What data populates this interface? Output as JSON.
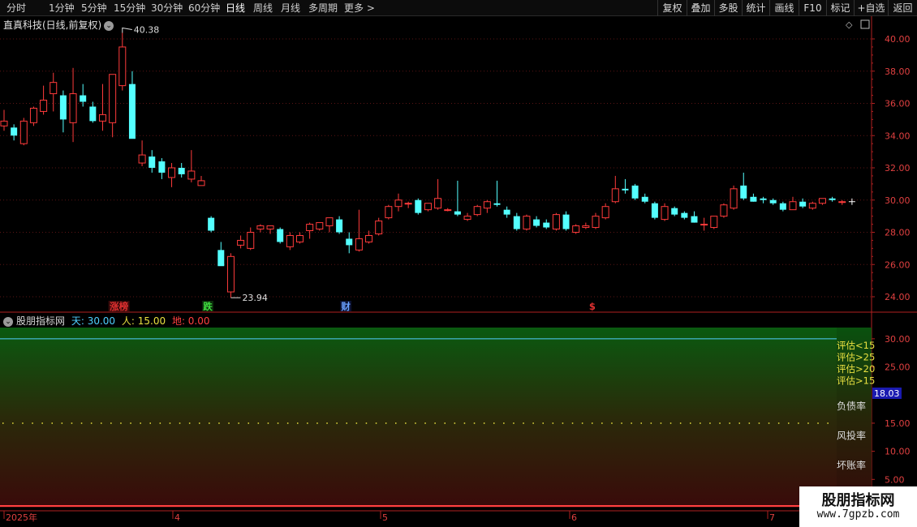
{
  "toolbar": {
    "periods": [
      "分时",
      "1分钟",
      "5分钟",
      "15分钟",
      "30分钟",
      "60分钟",
      "日线",
      "周线",
      "月线",
      "多周期",
      "更多 >"
    ],
    "active_period": "日线",
    "right_buttons": [
      "复权",
      "叠加",
      "多股",
      "统计",
      "画线",
      "F10",
      "标记",
      "+自选",
      "返回"
    ]
  },
  "main_chart": {
    "title": "直真科技(日线,前复权)",
    "high_label": "40.38",
    "low_label": "23.94",
    "y_ticks": [
      "40.00",
      "38.00",
      "36.00",
      "34.00",
      "32.00",
      "30.00",
      "28.00",
      "26.00",
      "24.00"
    ],
    "markers": [
      {
        "text": "涨榜",
        "color": "#e03030",
        "bg": "#3a0a0a"
      },
      {
        "text": "跌",
        "color": "#40e040",
        "bg": "#0a2a0a"
      },
      {
        "text": "财",
        "color": "#6aa0ff",
        "bg": "#0a1030"
      },
      {
        "text": "$",
        "color": "#e03030",
        "bg": "#000000"
      }
    ]
  },
  "indicator": {
    "name": "股朋指标网",
    "tian_label": "天: 30.00",
    "ren_label": "人: 15.00",
    "di_label": "地: 0.00",
    "y_ticks": [
      "30.00",
      "25.00",
      "15.00",
      "10.00",
      "5.00"
    ],
    "current_value": "18.03",
    "eval_labels": [
      "评估<15",
      "评估>25",
      "评估>20",
      "评估>15"
    ],
    "rate_labels": [
      "负债率",
      "风投率",
      "坏账率"
    ]
  },
  "x_axis": {
    "labels": [
      "2025年",
      "4",
      "5",
      "6",
      "7"
    ]
  },
  "watermark": {
    "line1": "股朋指标网",
    "line2": "www.7gpzb.com"
  },
  "colors": {
    "up": "#ff3b3b",
    "down": "#54ffff",
    "axis": "#b02020",
    "tian": "#4fd0ff",
    "ren": "#e8e040",
    "di": "#ff4040"
  },
  "chart_data": {
    "type": "candlestick",
    "title": "直真科技(日线,前复权)",
    "ylim": [
      23,
      41.5
    ],
    "candles": [
      {
        "o": 34.6,
        "h": 35.6,
        "l": 34.3,
        "c": 34.9
      },
      {
        "o": 34.5,
        "h": 34.7,
        "l": 33.7,
        "c": 34.0
      },
      {
        "o": 33.5,
        "h": 35.1,
        "l": 33.4,
        "c": 34.9
      },
      {
        "o": 34.8,
        "h": 35.8,
        "l": 34.6,
        "c": 35.7
      },
      {
        "o": 35.5,
        "h": 37.1,
        "l": 35.3,
        "c": 36.2
      },
      {
        "o": 36.6,
        "h": 37.9,
        "l": 35.5,
        "c": 37.3
      },
      {
        "o": 36.5,
        "h": 36.8,
        "l": 34.2,
        "c": 35.0
      },
      {
        "o": 34.8,
        "h": 38.2,
        "l": 33.6,
        "c": 36.6
      },
      {
        "o": 36.5,
        "h": 37.2,
        "l": 35.8,
        "c": 36.1
      },
      {
        "o": 35.8,
        "h": 36.1,
        "l": 34.8,
        "c": 34.9
      },
      {
        "o": 34.9,
        "h": 37.2,
        "l": 34.3,
        "c": 35.3
      },
      {
        "o": 34.8,
        "h": 37.5,
        "l": 33.9,
        "c": 37.8
      },
      {
        "o": 37.1,
        "h": 40.38,
        "l": 36.8,
        "c": 39.5
      },
      {
        "o": 37.2,
        "h": 38.0,
        "l": 34.0,
        "c": 33.8
      },
      {
        "o": 32.3,
        "h": 33.7,
        "l": 32.1,
        "c": 32.8
      },
      {
        "o": 32.7,
        "h": 33.1,
        "l": 31.7,
        "c": 32.0
      },
      {
        "o": 32.4,
        "h": 32.6,
        "l": 31.3,
        "c": 31.7
      },
      {
        "o": 31.4,
        "h": 32.3,
        "l": 30.8,
        "c": 32.0
      },
      {
        "o": 32.0,
        "h": 32.3,
        "l": 31.4,
        "c": 31.6
      },
      {
        "o": 31.3,
        "h": 33.1,
        "l": 31.1,
        "c": 31.8
      },
      {
        "o": 30.9,
        "h": 31.5,
        "l": 30.9,
        "c": 31.2
      },
      {
        "o": 28.9,
        "h": 29.0,
        "l": 28.0,
        "c": 28.1
      },
      {
        "o": 26.9,
        "h": 27.4,
        "l": 26.0,
        "c": 25.9
      },
      {
        "o": 24.3,
        "h": 26.7,
        "l": 23.94,
        "c": 26.5
      },
      {
        "o": 27.2,
        "h": 27.8,
        "l": 27.0,
        "c": 27.5
      },
      {
        "o": 27.0,
        "h": 28.3,
        "l": 26.9,
        "c": 28.0
      },
      {
        "o": 28.2,
        "h": 28.5,
        "l": 28.0,
        "c": 28.4
      },
      {
        "o": 28.2,
        "h": 28.4,
        "l": 27.9,
        "c": 28.4
      },
      {
        "o": 28.2,
        "h": 28.3,
        "l": 27.3,
        "c": 27.4
      },
      {
        "o": 27.1,
        "h": 28.0,
        "l": 26.9,
        "c": 27.8
      },
      {
        "o": 27.4,
        "h": 28.0,
        "l": 27.3,
        "c": 27.8
      },
      {
        "o": 28.1,
        "h": 28.6,
        "l": 27.6,
        "c": 28.5
      },
      {
        "o": 28.2,
        "h": 28.5,
        "l": 28.1,
        "c": 28.6
      },
      {
        "o": 28.4,
        "h": 28.7,
        "l": 28.0,
        "c": 28.9
      },
      {
        "o": 28.8,
        "h": 29.0,
        "l": 27.9,
        "c": 28.0
      },
      {
        "o": 27.6,
        "h": 28.0,
        "l": 26.7,
        "c": 27.2
      },
      {
        "o": 26.9,
        "h": 29.4,
        "l": 26.8,
        "c": 27.6
      },
      {
        "o": 27.4,
        "h": 28.1,
        "l": 27.3,
        "c": 27.8
      },
      {
        "o": 27.9,
        "h": 28.9,
        "l": 27.8,
        "c": 28.7
      },
      {
        "o": 28.9,
        "h": 29.7,
        "l": 28.8,
        "c": 29.6
      },
      {
        "o": 29.6,
        "h": 30.4,
        "l": 29.3,
        "c": 30.0
      },
      {
        "o": 29.8,
        "h": 29.9,
        "l": 29.5,
        "c": 29.8
      },
      {
        "o": 30.0,
        "h": 30.1,
        "l": 29.1,
        "c": 29.2
      },
      {
        "o": 29.4,
        "h": 29.8,
        "l": 29.3,
        "c": 29.8
      },
      {
        "o": 29.5,
        "h": 31.3,
        "l": 29.4,
        "c": 30.1
      },
      {
        "o": 29.4,
        "h": 29.5,
        "l": 29.3,
        "c": 29.4
      },
      {
        "o": 29.3,
        "h": 31.2,
        "l": 29.0,
        "c": 29.1
      },
      {
        "o": 28.8,
        "h": 29.2,
        "l": 28.7,
        "c": 29.0
      },
      {
        "o": 29.1,
        "h": 29.7,
        "l": 29.0,
        "c": 29.6
      },
      {
        "o": 29.5,
        "h": 30.0,
        "l": 29.2,
        "c": 29.9
      },
      {
        "o": 29.8,
        "h": 31.2,
        "l": 29.6,
        "c": 29.7
      },
      {
        "o": 29.4,
        "h": 29.6,
        "l": 28.9,
        "c": 29.1
      },
      {
        "o": 29.0,
        "h": 29.2,
        "l": 28.1,
        "c": 28.2
      },
      {
        "o": 28.2,
        "h": 29.1,
        "l": 28.1,
        "c": 29.0
      },
      {
        "o": 28.8,
        "h": 29.0,
        "l": 28.3,
        "c": 28.4
      },
      {
        "o": 28.6,
        "h": 28.8,
        "l": 28.2,
        "c": 28.3
      },
      {
        "o": 28.2,
        "h": 29.2,
        "l": 28.1,
        "c": 29.1
      },
      {
        "o": 29.1,
        "h": 29.3,
        "l": 28.1,
        "c": 28.2
      },
      {
        "o": 28.0,
        "h": 28.5,
        "l": 27.9,
        "c": 28.4
      },
      {
        "o": 28.3,
        "h": 28.6,
        "l": 28.2,
        "c": 28.4
      },
      {
        "o": 28.3,
        "h": 29.2,
        "l": 28.2,
        "c": 29.0
      },
      {
        "o": 28.9,
        "h": 29.8,
        "l": 28.8,
        "c": 29.6
      },
      {
        "o": 29.9,
        "h": 31.5,
        "l": 29.8,
        "c": 30.7
      },
      {
        "o": 30.7,
        "h": 31.3,
        "l": 30.4,
        "c": 30.6
      },
      {
        "o": 30.9,
        "h": 31.0,
        "l": 30.0,
        "c": 30.1
      },
      {
        "o": 30.2,
        "h": 30.4,
        "l": 29.8,
        "c": 29.9
      },
      {
        "o": 29.8,
        "h": 29.9,
        "l": 28.8,
        "c": 28.9
      },
      {
        "o": 28.8,
        "h": 29.8,
        "l": 28.7,
        "c": 29.6
      },
      {
        "o": 29.5,
        "h": 29.6,
        "l": 29.0,
        "c": 29.1
      },
      {
        "o": 29.2,
        "h": 29.3,
        "l": 28.8,
        "c": 28.9
      },
      {
        "o": 29.0,
        "h": 29.3,
        "l": 28.6,
        "c": 28.6
      },
      {
        "o": 28.5,
        "h": 28.9,
        "l": 28.1,
        "c": 28.5
      },
      {
        "o": 28.3,
        "h": 29.0,
        "l": 28.2,
        "c": 29.0
      },
      {
        "o": 29.0,
        "h": 29.8,
        "l": 28.9,
        "c": 29.7
      },
      {
        "o": 29.5,
        "h": 30.9,
        "l": 29.4,
        "c": 30.7
      },
      {
        "o": 30.9,
        "h": 31.7,
        "l": 30.0,
        "c": 30.1
      },
      {
        "o": 30.2,
        "h": 30.4,
        "l": 29.9,
        "c": 29.9
      },
      {
        "o": 30.1,
        "h": 30.2,
        "l": 29.8,
        "c": 30.0
      },
      {
        "o": 30.0,
        "h": 30.1,
        "l": 29.7,
        "c": 29.8
      },
      {
        "o": 29.8,
        "h": 29.9,
        "l": 29.3,
        "c": 29.4
      },
      {
        "o": 29.4,
        "h": 30.2,
        "l": 29.4,
        "c": 29.9
      },
      {
        "o": 29.9,
        "h": 30.1,
        "l": 29.5,
        "c": 29.6
      },
      {
        "o": 29.5,
        "h": 29.9,
        "l": 29.4,
        "c": 29.8
      },
      {
        "o": 29.8,
        "h": 30.1,
        "l": 29.7,
        "c": 30.1
      },
      {
        "o": 30.1,
        "h": 30.2,
        "l": 29.9,
        "c": 30.0
      },
      {
        "o": 29.9,
        "h": 30.0,
        "l": 29.7,
        "c": 29.9
      }
    ],
    "marker_candle_index": [
      11,
      20,
      34,
      59
    ],
    "indicator": {
      "name": "股朋指标网",
      "tian": 30.0,
      "ren": 15.0,
      "di": 0.0,
      "ylim": [
        0,
        32
      ]
    }
  }
}
